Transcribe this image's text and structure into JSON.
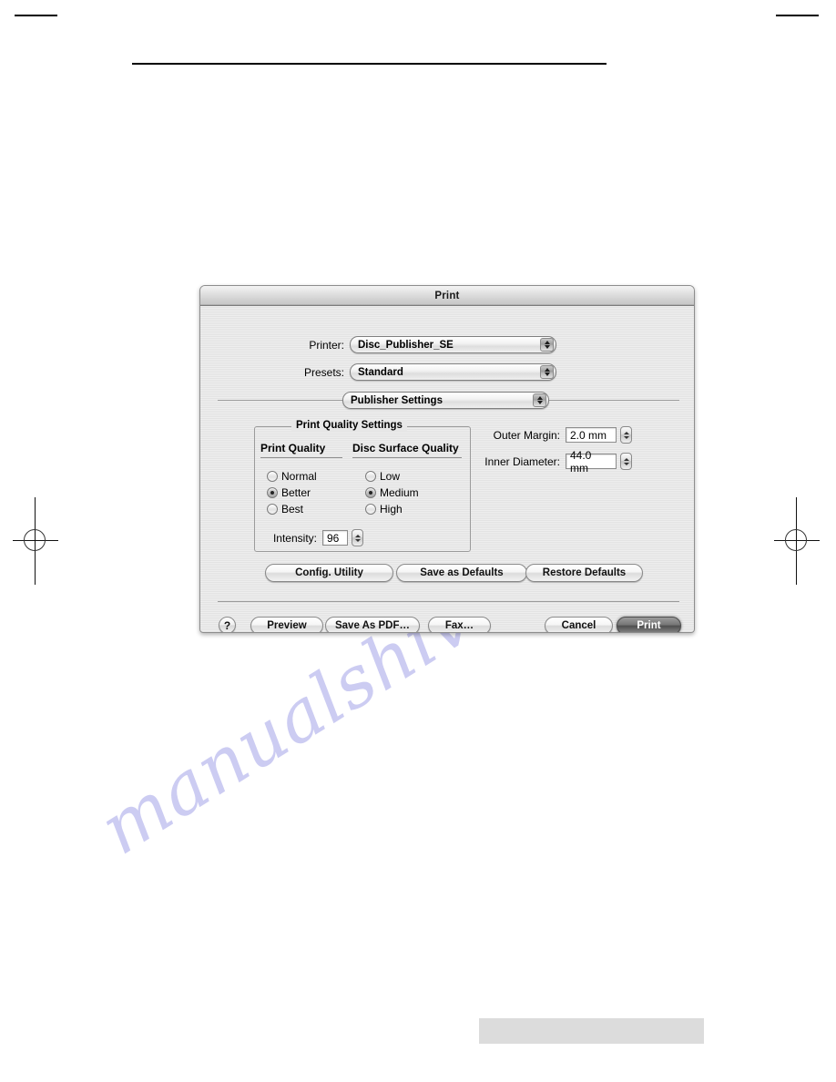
{
  "page": {
    "watermark": "manualshive.com"
  },
  "dialog": {
    "title": "Print",
    "printer": {
      "label": "Printer:",
      "value": "Disc_Publisher_SE"
    },
    "presets": {
      "label": "Presets:",
      "value": "Standard"
    },
    "pane": {
      "value": "Publisher Settings"
    },
    "quality_group": {
      "title": "Print Quality Settings",
      "print_quality": {
        "heading": "Print Quality",
        "options": [
          "Normal",
          "Better",
          "Best"
        ],
        "selected": "Better"
      },
      "disc_surface_quality": {
        "heading": "Disc Surface Quality",
        "options": [
          "Low",
          "Medium",
          "High"
        ],
        "selected": "Medium"
      },
      "intensity": {
        "label": "Intensity:",
        "value": "96"
      }
    },
    "margins": {
      "outer_margin": {
        "label": "Outer Margin:",
        "value": "2.0 mm"
      },
      "inner_diameter": {
        "label": "Inner Diameter:",
        "value": "44.0 mm"
      }
    },
    "utility_buttons": {
      "config": "Config. Utility",
      "save_defaults": "Save as Defaults",
      "restore_defaults": "Restore Defaults"
    },
    "action_buttons": {
      "help": "?",
      "preview": "Preview",
      "save_as_pdf": "Save As PDF…",
      "fax": "Fax…",
      "cancel": "Cancel",
      "print": "Print"
    }
  }
}
